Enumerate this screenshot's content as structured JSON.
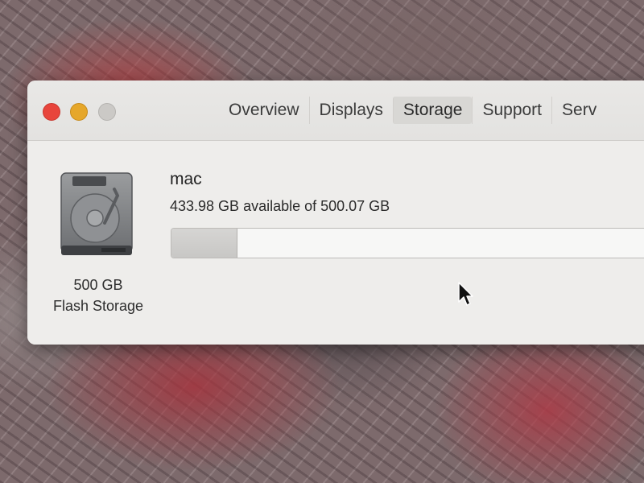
{
  "window": {
    "tabs": [
      {
        "label": "Overview",
        "active": false
      },
      {
        "label": "Displays",
        "active": false
      },
      {
        "label": "Storage",
        "active": true
      },
      {
        "label": "Support",
        "active": false
      },
      {
        "label": "Serv",
        "active": false
      }
    ]
  },
  "storage": {
    "disk_name": "mac",
    "available_text": "433.98 GB available of 500.07 GB",
    "used_fraction": 0.132,
    "capacity_label": "500 GB",
    "type_label": "Flash Storage"
  },
  "icons": {
    "disk": "hard-drive-icon",
    "cursor": "pointer-cursor-icon"
  },
  "colors": {
    "close": "#e8453c",
    "minimize": "#e6a72a",
    "zoom": "#cbc9c6"
  }
}
